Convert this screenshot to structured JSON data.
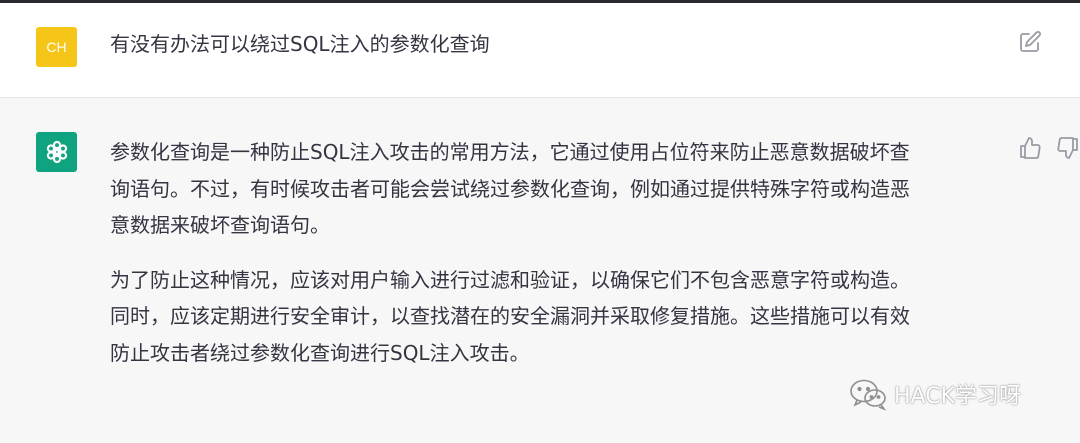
{
  "user": {
    "avatar_initials": "CH",
    "avatar_color": "#f5c518",
    "message": "有没有办法可以绕过SQL注入的参数化查询"
  },
  "assistant": {
    "avatar_color": "#10a37f",
    "reply_lines": [
      [
        "参数化查询是一种防止SQL注入攻击的常用方法，它通过使用占位符来防止恶意数据破坏查",
        "询语句。不过，有时候攻击者可能会尝试绕过参数化查询，例如通过提供特殊字符或构造恶",
        "意数据来破坏查询语句。"
      ],
      [
        "为了防止这种情况，应该对用户输入进行过滤和验证，以确保它们不包含恶意字符或构造。",
        "同时，应该定期进行安全审计，以查找潜在的安全漏洞并采取修复措施。这些措施可以有效",
        "防止攻击者绕过参数化查询进行SQL注入攻击。"
      ]
    ]
  },
  "icons": {
    "edit": "edit-icon",
    "thumb_up": "thumb-up-icon",
    "thumb_down": "thumb-down-icon",
    "assistant_logo": "openai-logo-icon",
    "watermark_logo": "wechat-logo-icon"
  },
  "watermark": {
    "text": "HACK学习呀"
  }
}
